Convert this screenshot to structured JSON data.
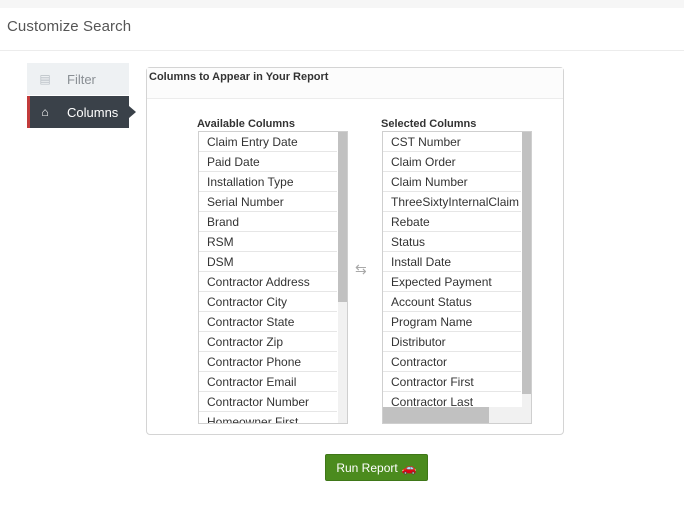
{
  "page": {
    "title": "Customize Search"
  },
  "sidebar": {
    "tabs": [
      {
        "label": "Filter",
        "icon": "filter-icon"
      },
      {
        "label": "Columns",
        "icon": "home-icon"
      }
    ],
    "active_tab": "Columns"
  },
  "panel": {
    "title": "Columns to Appear in Your Report",
    "available": {
      "heading": "Available Columns",
      "items": [
        "Claim Entry Date",
        "Paid Date",
        "Installation Type",
        "Serial Number",
        "Brand",
        "RSM",
        "DSM",
        "Contractor Address",
        "Contractor City",
        "Contractor State",
        "Contractor Zip",
        "Contractor Phone",
        "Contractor Email",
        "Contractor Number",
        "Homeowner First"
      ]
    },
    "selected": {
      "heading": "Selected Columns",
      "items": [
        "CST Number",
        "Claim Order",
        "Claim Number",
        "ThreeSixtyInternalClaim",
        "Rebate",
        "Status",
        "Install Date",
        "Expected Payment",
        "Account Status",
        "Program Name",
        "Distributor",
        "Contractor",
        "Contractor First",
        "Contractor Last"
      ]
    },
    "swap_icon": "swap-arrows-icon"
  },
  "actions": {
    "run_label": "Run Report",
    "run_icon": "car-icon"
  },
  "colors": {
    "run_button": "#4b8b1e",
    "active_tab": "#3a4149",
    "active_accent": "#c23b3b"
  }
}
